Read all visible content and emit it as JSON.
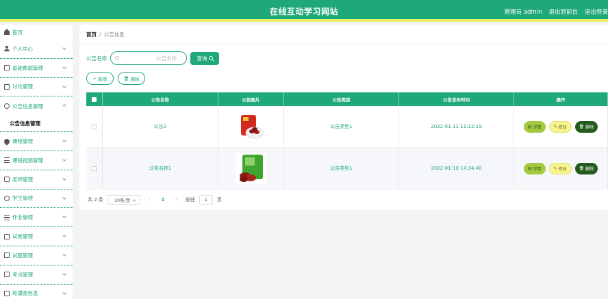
{
  "header": {
    "title": "在线互动学习网站",
    "links": [
      "管理员 admin",
      "退出到前台",
      "退出登录"
    ]
  },
  "sidebar": {
    "home": "首页",
    "items": [
      {
        "label": "个人中心",
        "icon": "user-icon"
      },
      {
        "label": "基础数据管理",
        "icon": "box-icon"
      },
      {
        "label": "讨论管理",
        "icon": "box-icon"
      },
      {
        "label": "公告信息管理",
        "icon": "clock-icon",
        "expanded": true,
        "sub": "公告信息管理"
      },
      {
        "label": "课程管理",
        "icon": "pin-icon"
      },
      {
        "label": "课程视频管理",
        "icon": "sliders-icon"
      },
      {
        "label": "老师管理",
        "icon": "phone-icon"
      },
      {
        "label": "学生管理",
        "icon": "circle-icon"
      },
      {
        "label": "作业管理",
        "icon": "list-icon"
      },
      {
        "label": "试卷管理",
        "icon": "copy-icon"
      },
      {
        "label": "试题管理",
        "icon": "mail-icon"
      },
      {
        "label": "考试管理",
        "icon": "box-icon"
      },
      {
        "label": "轮播图信息",
        "icon": "carousel-icon"
      }
    ]
  },
  "breadcrumb": {
    "home": "首页",
    "sep": "/",
    "current": "公告信息"
  },
  "search": {
    "label": "公告名称",
    "placeholder": "公告名称",
    "button": "查询"
  },
  "actions": {
    "add": "新增",
    "delete": "删除"
  },
  "table": {
    "headers": [
      "公告名称",
      "公告图片",
      "公告类型",
      "公告发布时间",
      "操作"
    ],
    "rows": [
      {
        "name": "公告2",
        "type": "公告类型1",
        "time": "2022-01-11 11:12:19",
        "image": "red-package"
      },
      {
        "name": "公告名称1",
        "type": "公告类型1",
        "time": "2022-01-10 14:34:40",
        "image": "green-package"
      }
    ],
    "ops": {
      "detail": "详情",
      "edit": "修改",
      "delete": "删除"
    }
  },
  "pagination": {
    "total": "共 2 条",
    "page_size": "10条/页",
    "prev": "‹",
    "current": "1",
    "next": "›",
    "goto_label": "前往",
    "goto_value": "1",
    "page_unit": "页"
  },
  "colors": {
    "primary": "#1fa87a",
    "accent_bar": "#e8f06c",
    "detail": "#a3c940",
    "edit": "#f7f48f",
    "delete": "#235b1c"
  }
}
